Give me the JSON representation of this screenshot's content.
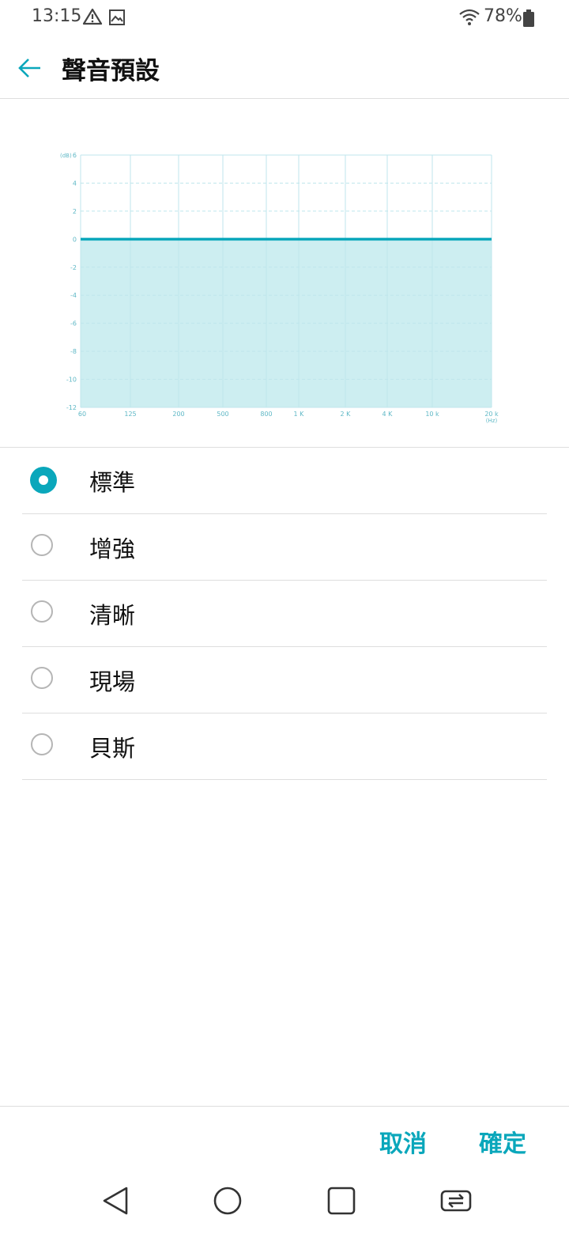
{
  "status": {
    "time": "13:15",
    "battery": "78%"
  },
  "app_bar": {
    "title": "聲音預設"
  },
  "chart_data": {
    "type": "area",
    "x": [
      "60",
      "125",
      "200",
      "500",
      "800",
      "1 K",
      "2 K",
      "4 K",
      "10 k",
      "20 k"
    ],
    "series": [
      {
        "values": [
          0,
          0,
          0,
          0,
          0,
          0,
          0,
          0,
          0,
          0
        ]
      }
    ],
    "y_ticks": [
      6,
      4,
      2,
      0,
      -2,
      -4,
      -6,
      -8,
      -10,
      -12
    ],
    "ylim": [
      -12,
      6
    ],
    "y_unit": "(dB)",
    "x_unit": "(Hz)",
    "colors": {
      "line": "#0aa7bb",
      "fill": "#cdeef1",
      "grid": "#bfe6ec"
    }
  },
  "options": [
    {
      "label": "標準",
      "selected": true
    },
    {
      "label": "增強",
      "selected": false
    },
    {
      "label": "清晰",
      "selected": false
    },
    {
      "label": "現場",
      "selected": false
    },
    {
      "label": "貝斯",
      "selected": false
    }
  ],
  "footer": {
    "cancel": "取消",
    "ok": "確定"
  },
  "accent": "#0aa7bb"
}
